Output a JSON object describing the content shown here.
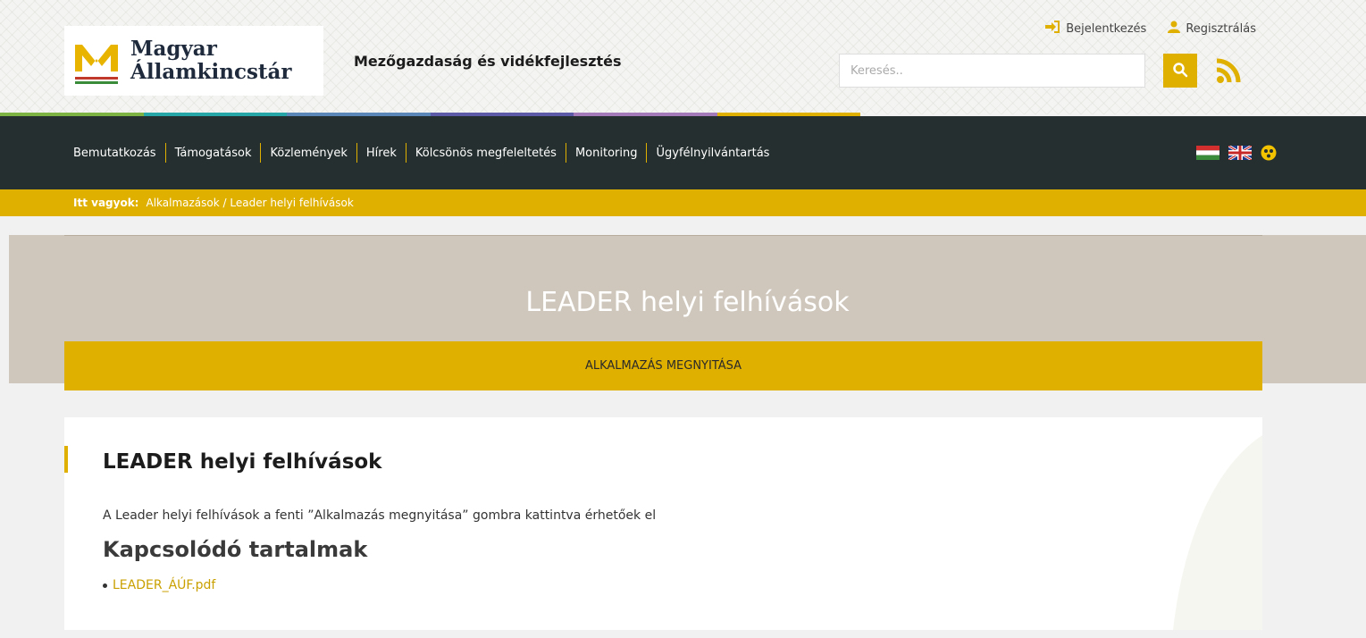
{
  "header": {
    "logo_line1": "Magyar",
    "logo_line2": "Államkincstár",
    "site_title": "Mezőgazdaság és vidékfejlesztés",
    "login_label": "Bejelentkezés",
    "register_label": "Regisztrálás",
    "search_placeholder": "Keresés.."
  },
  "nav": {
    "items": [
      "Bemutatkozás",
      "Támogatások",
      "Közlemények",
      "Hírek",
      "Kölcsönös megfeleltetés",
      "Monitoring",
      "Ügyfélnyilvántartás"
    ]
  },
  "breadcrumb": {
    "prefix": "Itt vagyok:",
    "path": "Alkalmazások / Leader helyi felhívások"
  },
  "hero": {
    "title": "LEADER helyi felhívások",
    "button_label": "ALKALMAZÁS MEGNYITÁSA"
  },
  "content": {
    "title": "LEADER helyi felhívások",
    "text": "A Leader helyi felhívások a fenti ”Alkalmazás megnyitása” gombra kattintva érhetőek el",
    "related_title": "Kapcsolódó tartalmak",
    "related_links": [
      "LEADER_ÁÚF.pdf"
    ]
  },
  "colors": {
    "accent": "#e0b000",
    "nav_bg": "#262f2f",
    "hero_bg": "#cfc7bc",
    "strip": [
      "#7cb342",
      "#26a6a6",
      "#5b86b8",
      "#5d5ba8",
      "#a57ab8",
      "#e0b000"
    ]
  },
  "icons": [
    "login-icon",
    "user-icon",
    "search-icon",
    "rss-icon",
    "hungarian-flag-icon",
    "uk-flag-icon",
    "accessibility-icon"
  ]
}
